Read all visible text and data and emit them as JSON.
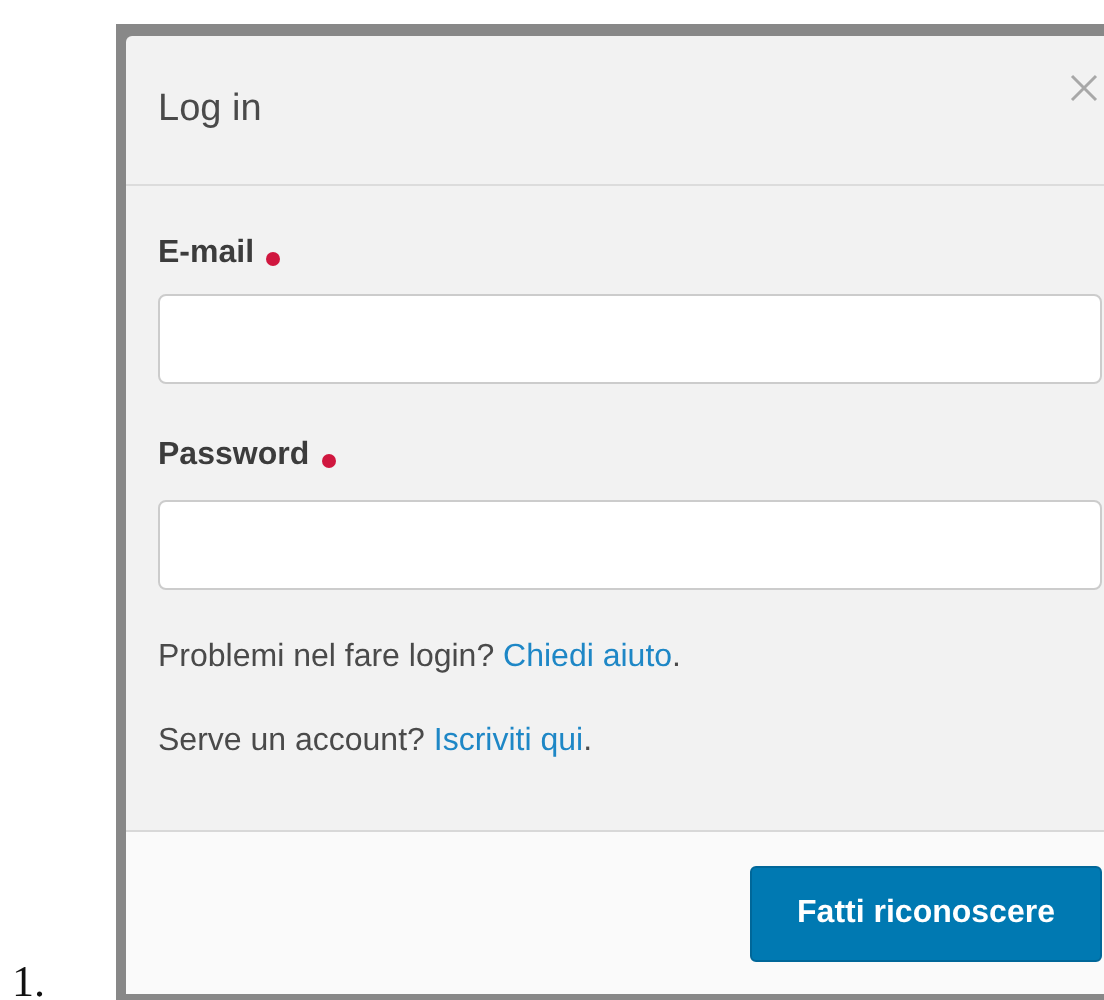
{
  "list_marker": "1.",
  "dialog": {
    "title": "Log in",
    "fields": [
      {
        "label": "E-mail",
        "required": true
      },
      {
        "label": "Password",
        "required": true
      }
    ],
    "help_lines": [
      {
        "text": "Problemi nel fare login?",
        "link": "Chiedi aiuto",
        "suffix": "."
      },
      {
        "text": "Serve un account?",
        "link": "Iscriviti qui",
        "suffix": "."
      }
    ],
    "submit": "Fatti riconoscere"
  }
}
